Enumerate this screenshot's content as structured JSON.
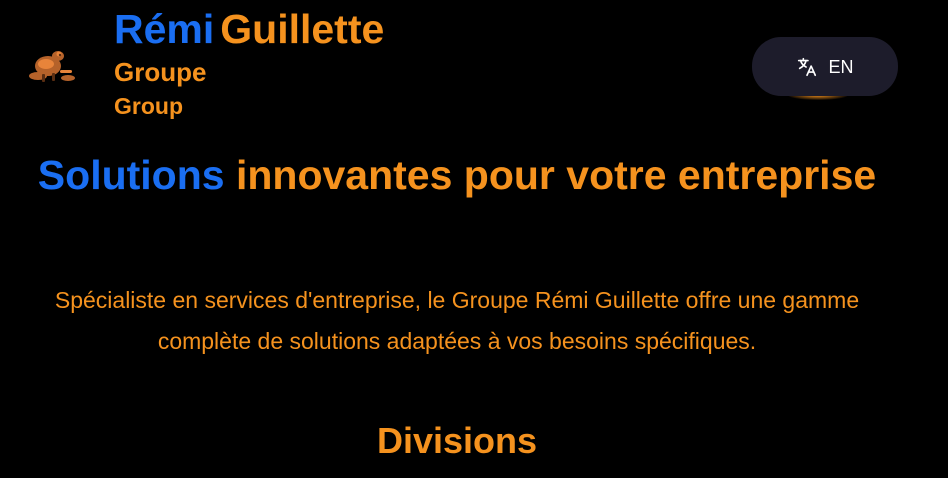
{
  "header": {
    "logo_icon": "beaver-logo-icon",
    "brand_first": "Rémi",
    "brand_last": "Guillette",
    "brand_line2": "Groupe",
    "brand_line3": "Group",
    "language_button": {
      "icon": "translate-icon",
      "label": "EN"
    }
  },
  "hero": {
    "title_accent": "Solutions",
    "title_rest": "innovantes pour votre entreprise",
    "description": "Spécialiste en services d'entreprise, le Groupe Rémi Guillette offre une gamme complète de solutions adaptées à vos besoins spécifiques."
  },
  "divisions": {
    "title": "Divisions"
  },
  "colors": {
    "background": "#000000",
    "accent_blue": "#1a6ef2",
    "accent_orange": "#f5921e",
    "button_bg": "#1d1c2b",
    "button_text": "#ffffff"
  }
}
